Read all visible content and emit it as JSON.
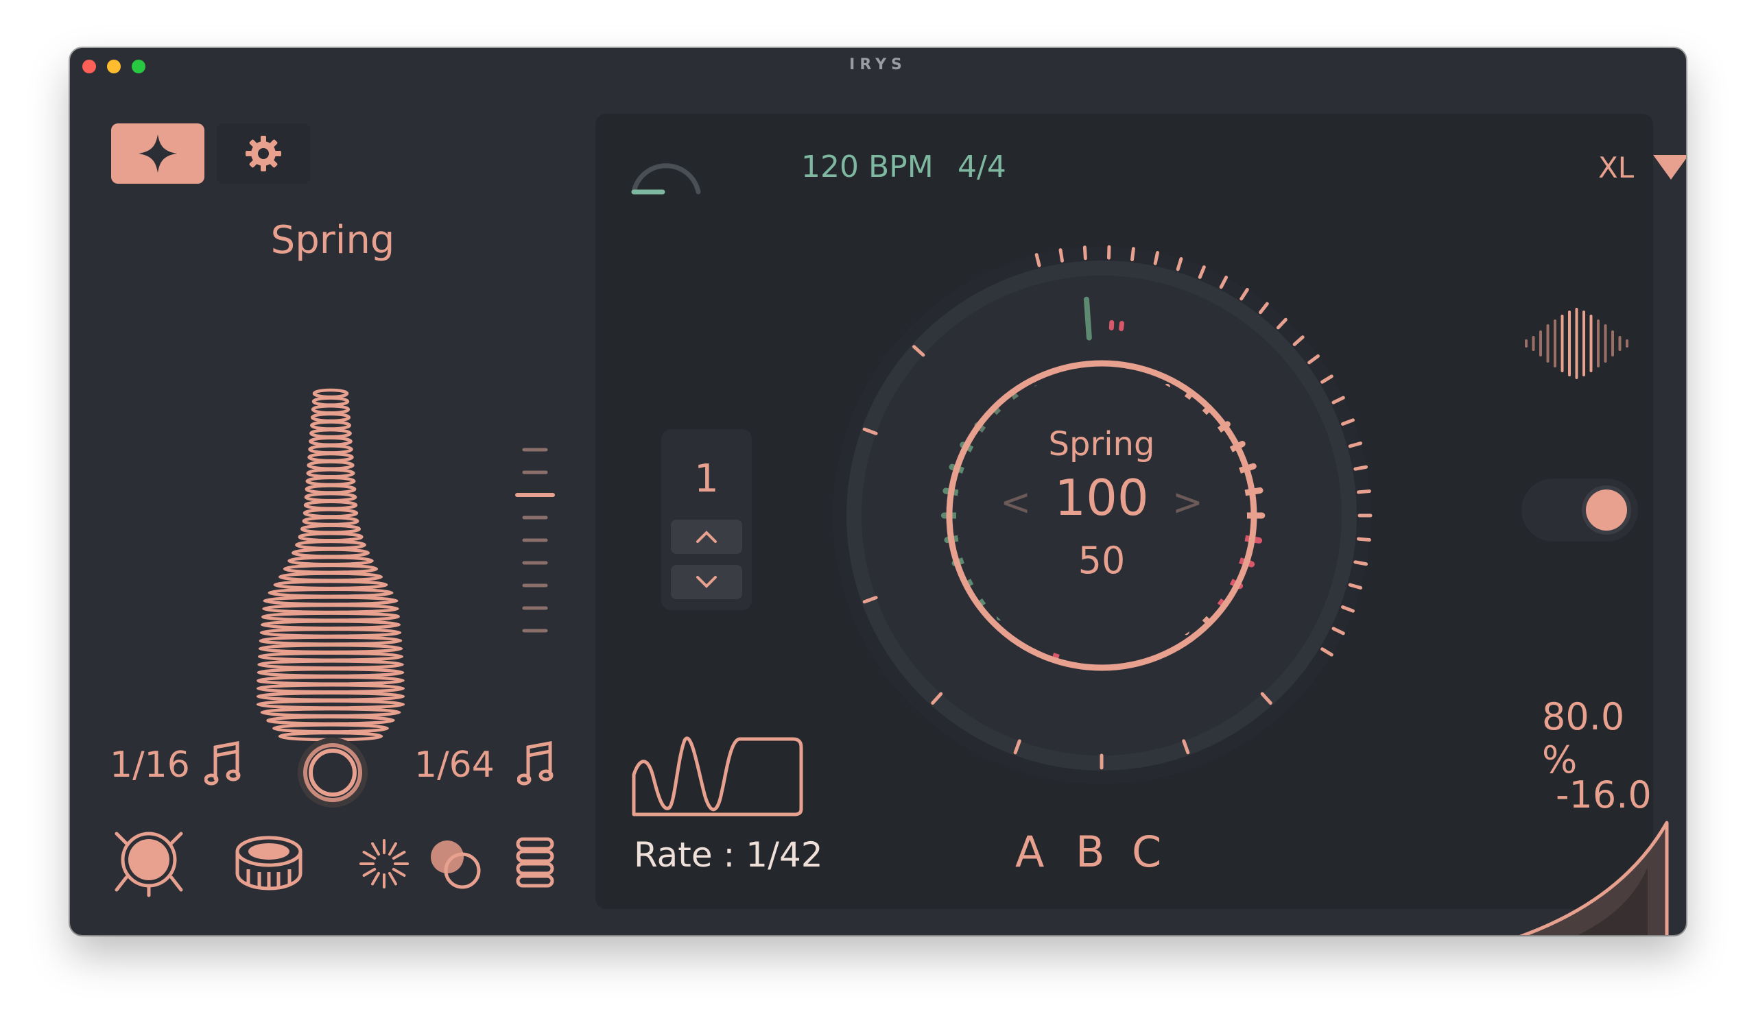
{
  "window": {
    "title": "IRYS"
  },
  "left": {
    "preset": "Spring",
    "rate_left": "1/16",
    "rate_right": "1/64",
    "slider_level": 0.3,
    "icons": [
      "drum-icon",
      "snare-icon",
      "burst-icon",
      "overlap-circles-icon",
      "stack-icon"
    ]
  },
  "panel": {
    "bpm": "120 BPM",
    "time_signature": "4/4",
    "size": "XL",
    "stepper_value": "1",
    "dial": {
      "name": "Spring",
      "value": "100",
      "sub_value": "50",
      "prev": "<",
      "next": ">"
    },
    "rate_label": "Rate : 1/42",
    "ab_buttons": [
      "A",
      "B",
      "C"
    ],
    "toggle_on": true,
    "percent": "80.0 %",
    "db_value": "-16.0"
  },
  "colors": {
    "accent": "#e8a08f",
    "accent_hot": "#d9576a",
    "teal": "#7eb8a0",
    "green": "#5e8a72",
    "bg": "#2b2e35",
    "panel": "#24272c"
  }
}
